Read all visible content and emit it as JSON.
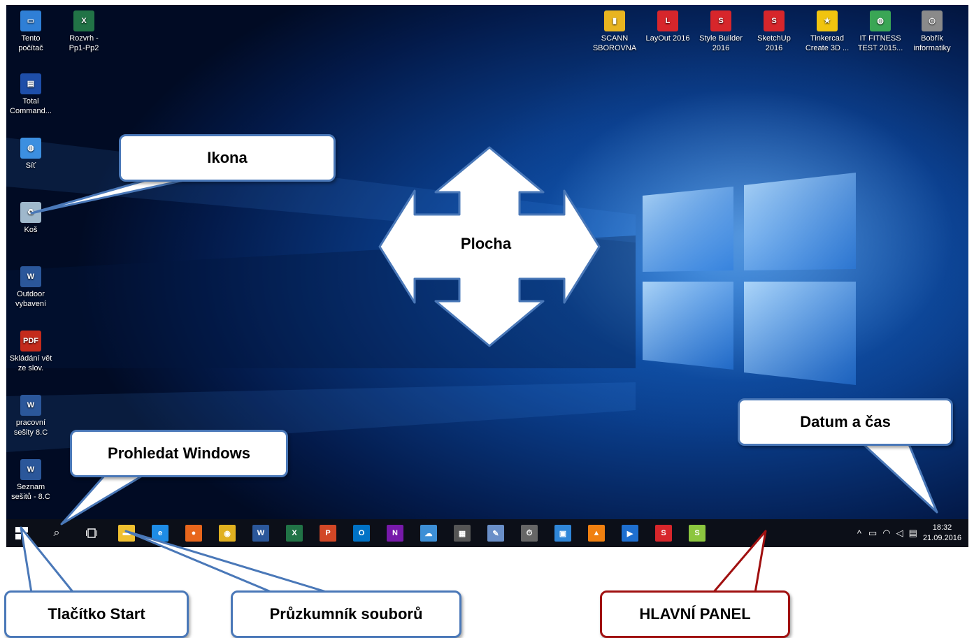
{
  "desktop": {
    "left_icons": [
      {
        "label": "Tento\npočítač",
        "icon": "computer-icon",
        "color": "#2f7fd6",
        "glyph": "▭"
      },
      {
        "label": "Total\nCommand...",
        "icon": "floppy-icon",
        "color": "#1e4ea8",
        "glyph": "▤"
      },
      {
        "label": "Síť",
        "icon": "network-globe-icon",
        "color": "#3c8fe0",
        "glyph": "◍"
      },
      {
        "label": "Koš",
        "icon": "recycle-bin-icon",
        "color": "#9fb8cc",
        "glyph": "♻"
      },
      {
        "label": "Outdoor\nvybavení",
        "icon": "word-doc-icon",
        "color": "#2b579a",
        "glyph": "W"
      },
      {
        "label": "Skládání vět\nze slov.",
        "icon": "pdf-icon",
        "color": "#c42b1c",
        "glyph": "PDF"
      },
      {
        "label": "pracovní\nsešity 8.C",
        "icon": "word-doc-icon",
        "color": "#2b579a",
        "glyph": "W"
      },
      {
        "label": "Seznam\nsešitů - 8.C",
        "icon": "word-doc-icon",
        "color": "#2b579a",
        "glyph": "W"
      }
    ],
    "second_column": [
      {
        "label": "Rozvrh -\nPp1-Pp2",
        "icon": "excel-doc-icon",
        "color": "#217346",
        "glyph": "X"
      }
    ],
    "top_right_icons": [
      {
        "label": "SCANN\nSBOROVNA",
        "icon": "folder-shortcut-icon",
        "color": "#e8b420",
        "glyph": "▮"
      },
      {
        "label": "LayOut 2016",
        "icon": "layout-icon",
        "color": "#d7262b",
        "glyph": "L"
      },
      {
        "label": "Style Builder\n2016",
        "icon": "style-builder-icon",
        "color": "#d7262b",
        "glyph": "S"
      },
      {
        "label": "SketchUp\n2016",
        "icon": "sketchup-icon",
        "color": "#d7262b",
        "glyph": "S"
      },
      {
        "label": "Tinkercad\nCreate 3D ...",
        "icon": "star-icon",
        "color": "#f1c40f",
        "glyph": "★"
      },
      {
        "label": "IT FITNESS\nTEST 2015...",
        "icon": "globe-icon",
        "color": "#3aa655",
        "glyph": "◍"
      },
      {
        "label": "Bobřík\ninformatiky",
        "icon": "disc-icon",
        "color": "#8a8a8a",
        "glyph": "◎"
      }
    ]
  },
  "taskbar": {
    "apps": [
      {
        "name": "file-explorer-icon",
        "color": "#f0c030",
        "glyph": "▬"
      },
      {
        "name": "edge-icon",
        "color": "#1e8ce6",
        "glyph": "e"
      },
      {
        "name": "firefox-icon",
        "color": "#e8661c",
        "glyph": "●"
      },
      {
        "name": "chrome-icon",
        "color": "#e0b020",
        "glyph": "◉"
      },
      {
        "name": "word-icon",
        "color": "#2b579a",
        "glyph": "W"
      },
      {
        "name": "excel-icon",
        "color": "#217346",
        "glyph": "X"
      },
      {
        "name": "powerpoint-icon",
        "color": "#d24726",
        "glyph": "P"
      },
      {
        "name": "outlook-icon",
        "color": "#0072c6",
        "glyph": "O"
      },
      {
        "name": "onenote-icon",
        "color": "#7719aa",
        "glyph": "N"
      },
      {
        "name": "onedrive-icon",
        "color": "#3d8fd6",
        "glyph": "☁"
      },
      {
        "name": "calculator-icon",
        "color": "#555555",
        "glyph": "▦"
      },
      {
        "name": "paint-icon",
        "color": "#6a8fc8",
        "glyph": "✎"
      },
      {
        "name": "alarm-clock-icon",
        "color": "#666666",
        "glyph": "⏱"
      },
      {
        "name": "image-viewer-icon",
        "color": "#2f86d8",
        "glyph": "▣"
      },
      {
        "name": "vlc-icon",
        "color": "#f08010",
        "glyph": "▲"
      },
      {
        "name": "media-player-icon",
        "color": "#1e6fd0",
        "glyph": "▶"
      },
      {
        "name": "sketchup-taskbar-icon",
        "color": "#d7262b",
        "glyph": "S"
      },
      {
        "name": "green-app-icon",
        "color": "#8cc63f",
        "glyph": "S"
      }
    ],
    "time": "18:32",
    "date": "21.09.2016"
  },
  "callouts": {
    "ikona": "Ikona",
    "plocha": "Plocha",
    "prohledat": "Prohledat Windows",
    "datum": "Datum a čas",
    "start": "Tlačítko Start",
    "pruzkumnik": "Průzkumník souborů",
    "hlavni_panel": "HLAVNÍ PANEL"
  }
}
